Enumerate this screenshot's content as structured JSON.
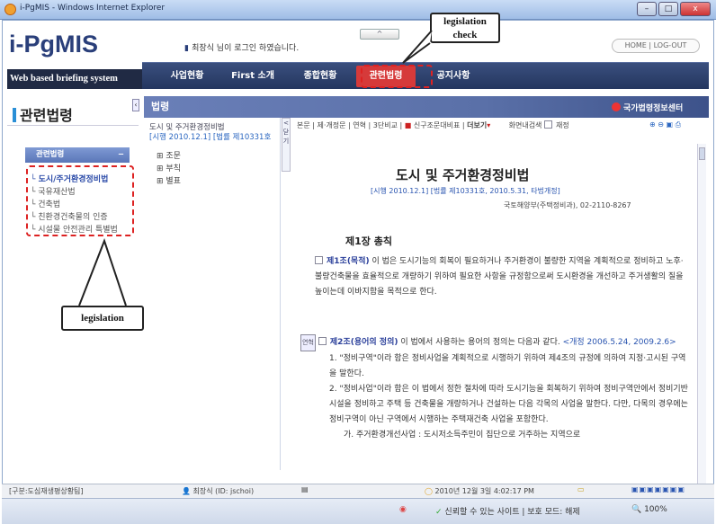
{
  "window": {
    "title": "i-PgMIS - Windows Internet Explorer",
    "controls": [
      "–",
      "□",
      "x"
    ]
  },
  "header": {
    "logo": "i-PgMIS",
    "welcome": "최장식 님이 로그인 하였습니다.",
    "tagline": "Web based briefing system",
    "home_logout": "HOME | LOG-OUT",
    "collapse": "^"
  },
  "nav": {
    "items": [
      "사업현황",
      "First 소개",
      "종합현황",
      "관련법령",
      "공지사항"
    ],
    "active": "관련법령"
  },
  "sidebar": {
    "title": "관련법령",
    "menu_head": "관련법령",
    "menu_toggle": "−",
    "items": [
      {
        "label": "도시/주거환경정비법",
        "active": true
      },
      {
        "label": "국유재산법",
        "active": false
      },
      {
        "label": "건축법",
        "active": false
      },
      {
        "label": "친환경건축물의 인증",
        "active": false
      },
      {
        "label": "시설물 안전관리 특별법",
        "active": false
      }
    ]
  },
  "content": {
    "heading": "법령",
    "gov_logo": "국가법령정보센터",
    "tree": {
      "title": "도시 및 주거환경정비법",
      "subtitle": "[시행 2010.12.1] [법률 제10331호",
      "items": [
        "조문",
        "부칙",
        "별표"
      ],
      "collapse": "< 닫기"
    },
    "toolbar": {
      "links": "본문 | 제·개정문 | 연혁 | 3단비교 |",
      "new_old": "신구조문대비표",
      "more": "더보기",
      "search": "화면내검색",
      "checkbox": "재정"
    }
  },
  "document": {
    "title": "도시 및 주거환경정비법",
    "subtitle": "[시행 2010.12.1] [법률 제10331호, 2010.5.31, 타법개정]",
    "ministry": "국토해양부(주택정비과), 02-2110-8267",
    "chapter": "제1장 총칙",
    "article1_head": "제1조(목적)",
    "article1_body": "이 법은 도시기능의 회복이 필요하거나 주거환경이 불량한 지역을 계획적으로 정비하고 노후·불량건축물을 효율적으로 개량하기 위하여 필요한 사항을 규정함으로써 도시환경을 개선하고 주거생활의 질을 높이는데 이바지함을 목적으로 한다.",
    "article2_tag": "연혁",
    "article2_head": "제2조(용어의 정의)",
    "article2_body": "이 법에서 사용하는 용어의 정의는 다음과 같다.",
    "article2_amend": "<개정 2006.5.24, 2009.2.6>",
    "item1": "1. \"정비구역\"이라 함은 정비사업을 계획적으로 시행하기 위하여 제4조의 규정에 의하여 지정·고시된 구역을 말한다.",
    "item2": "2. \"정비사업\"이라 함은 이 법에서 정한 절차에 따라 도시기능을 회복하기 위하여 정비구역안에서 정비기반시설을 정비하고 주택 등 건축물을 개량하거나 건설하는 다음 각목의 사업을 말한다. 다만, 다목의 경우에는 정비구역이 아닌 구역에서 시행하는 주택재건축 사업을 포함한다.",
    "item2a": "가. 주거환경개선사업 : 도시저소득주민이 집단으로 거주하는 지역으로"
  },
  "status": {
    "left": "[구분:도심재생평상황팀]",
    "user": "최장식 (ID: jschoi)",
    "datetime": "2010년 12월 3일 4:02:17 PM"
  },
  "iebar": {
    "trusted": "신뢰할 수 있는 사이트 | 보호 모드: 해제",
    "zoom": "100%"
  },
  "annotations": {
    "check": "legislation\ncheck",
    "legislation": "legislation"
  }
}
